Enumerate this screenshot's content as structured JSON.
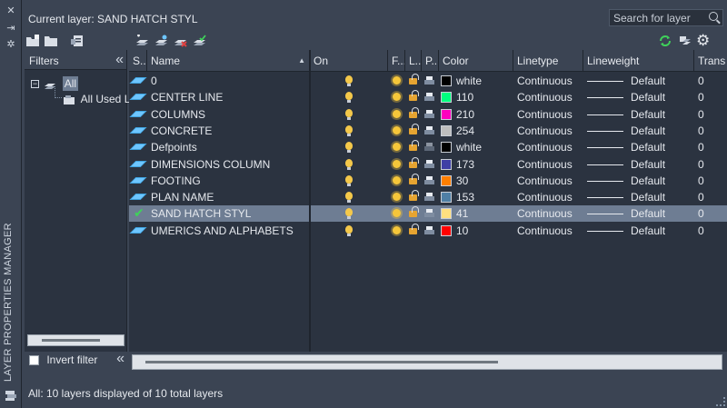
{
  "panel": {
    "vertical_title": "LAYER PROPERTIES MANAGER"
  },
  "header": {
    "current_layer": "Current layer: SAND HATCH STYL",
    "search_placeholder": "Search for layer"
  },
  "filters": {
    "title": "Filters",
    "tree": [
      {
        "label": "All",
        "expanded": true
      },
      {
        "label": "All Used La"
      }
    ],
    "invert_label": "Invert filter",
    "invert_checked": false
  },
  "columns": [
    "S...",
    "Name",
    "On",
    "F...",
    "L...",
    "P...",
    "Color",
    "Linetype",
    "Lineweight",
    "Trans"
  ],
  "layers": [
    {
      "name": "0",
      "current": false,
      "color_name": "white",
      "color_hex": "#000000",
      "linetype": "Continuous",
      "lineweight": "Default",
      "trans": "0",
      "plot": true
    },
    {
      "name": "CENTER LINE",
      "current": false,
      "color_name": "110",
      "color_hex": "#00ff7f",
      "linetype": "Continuous",
      "lineweight": "Default",
      "trans": "0",
      "plot": true
    },
    {
      "name": "COLUMNS",
      "current": false,
      "color_name": "210",
      "color_hex": "#ff00bf",
      "linetype": "Continuous",
      "lineweight": "Default",
      "trans": "0",
      "plot": true
    },
    {
      "name": "CONCRETE",
      "current": false,
      "color_name": "254",
      "color_hex": "#bebebe",
      "linetype": "Continuous",
      "lineweight": "Default",
      "trans": "0",
      "plot": true
    },
    {
      "name": "Defpoints",
      "current": false,
      "color_name": "white",
      "color_hex": "#000000",
      "linetype": "Continuous",
      "lineweight": "Default",
      "trans": "0",
      "plot": false
    },
    {
      "name": "DIMENSIONS COLUMN",
      "current": false,
      "color_name": "173",
      "color_hex": "#3f3fa5",
      "linetype": "Continuous",
      "lineweight": "Default",
      "trans": "0",
      "plot": true
    },
    {
      "name": "FOOTING",
      "current": false,
      "color_name": "30",
      "color_hex": "#ff7f00",
      "linetype": "Continuous",
      "lineweight": "Default",
      "trans": "0",
      "plot": true
    },
    {
      "name": "PLAN NAME",
      "current": false,
      "color_name": "153",
      "color_hex": "#4f7fa5",
      "linetype": "Continuous",
      "lineweight": "Default",
      "trans": "0",
      "plot": true
    },
    {
      "name": "SAND HATCH STYL",
      "current": true,
      "color_name": "41",
      "color_hex": "#ffdf7f",
      "linetype": "Continuous",
      "lineweight": "Default",
      "trans": "0",
      "plot": true
    },
    {
      "name": "UMERICS AND ALPHABETS",
      "current": false,
      "color_name": "10",
      "color_hex": "#ff0000",
      "linetype": "Continuous",
      "lineweight": "Default",
      "trans": "0",
      "plot": true
    }
  ],
  "status": "All: 10 layers displayed of 10 total layers"
}
